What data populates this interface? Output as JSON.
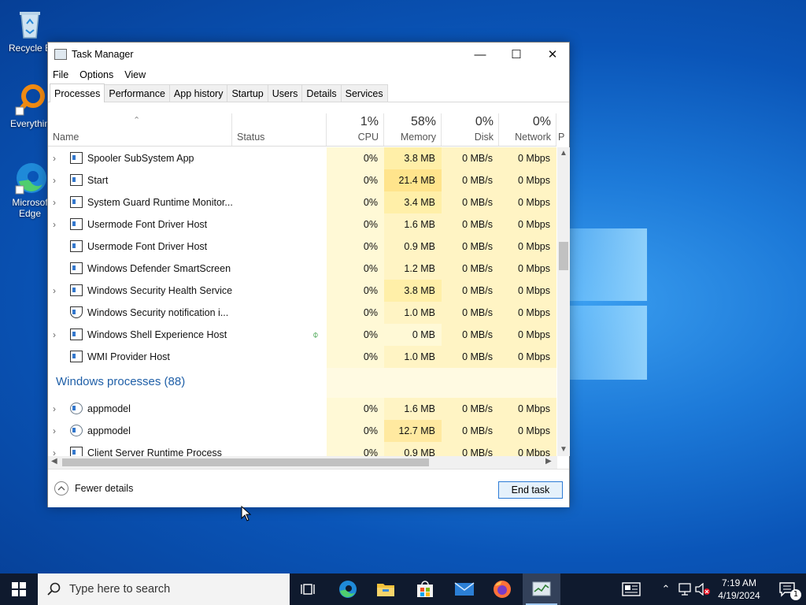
{
  "desktop": {
    "icons": [
      {
        "label": "Recycle B",
        "icon": "recycle-bin-icon"
      },
      {
        "label": "Everythin",
        "icon": "everything-search-icon"
      },
      {
        "label": "Microsof Edge",
        "icon": "edge-icon"
      }
    ]
  },
  "window": {
    "title": "Task Manager",
    "controls": {
      "minimize": "—",
      "maximize": "☐",
      "close": "✕"
    },
    "menu": [
      "File",
      "Options",
      "View"
    ],
    "tabs": [
      "Processes",
      "Performance",
      "App history",
      "Startup",
      "Users",
      "Details",
      "Services"
    ],
    "active_tab": "Processes",
    "columns": {
      "name": "Name",
      "status": "Status",
      "cpu": {
        "pct": "1%",
        "label": "CPU"
      },
      "memory": {
        "pct": "58%",
        "label": "Memory"
      },
      "disk": {
        "pct": "0%",
        "label": "Disk"
      },
      "network": {
        "pct": "0%",
        "label": "Network"
      },
      "power": "P"
    },
    "rows": [
      {
        "name": "Spooler SubSystem App",
        "expand": "›",
        "cpu": "0%",
        "memory": "3.8 MB",
        "disk": "0 MB/s",
        "network": "0 Mbps"
      },
      {
        "name": "Start",
        "expand": "›",
        "cpu": "0%",
        "memory": "21.4 MB",
        "disk": "0 MB/s",
        "network": "0 Mbps"
      },
      {
        "name": "System Guard Runtime Monitor...",
        "expand": "›",
        "cpu": "0%",
        "memory": "3.4 MB",
        "disk": "0 MB/s",
        "network": "0 Mbps"
      },
      {
        "name": "Usermode Font Driver Host",
        "expand": "›",
        "cpu": "0%",
        "memory": "1.6 MB",
        "disk": "0 MB/s",
        "network": "0 Mbps"
      },
      {
        "name": "Usermode Font Driver Host",
        "expand": "",
        "cpu": "0%",
        "memory": "0.9 MB",
        "disk": "0 MB/s",
        "network": "0 Mbps"
      },
      {
        "name": "Windows Defender SmartScreen",
        "expand": "",
        "cpu": "0%",
        "memory": "1.2 MB",
        "disk": "0 MB/s",
        "network": "0 Mbps"
      },
      {
        "name": "Windows Security Health Service",
        "expand": "›",
        "cpu": "0%",
        "memory": "3.8 MB",
        "disk": "0 MB/s",
        "network": "0 Mbps"
      },
      {
        "name": "Windows Security notification i...",
        "expand": "",
        "cpu": "0%",
        "memory": "1.0 MB",
        "disk": "0 MB/s",
        "network": "0 Mbps"
      },
      {
        "name": "Windows Shell Experience Host",
        "expand": "›",
        "cpu": "0%",
        "memory": "0 MB",
        "disk": "0 MB/s",
        "network": "0 Mbps"
      },
      {
        "name": "WMI Provider Host",
        "expand": "",
        "cpu": "0%",
        "memory": "1.0 MB",
        "disk": "0 MB/s",
        "network": "0 Mbps"
      }
    ],
    "group": {
      "label": "Windows processes (88)"
    },
    "group_rows": [
      {
        "name": "appmodel",
        "expand": "›",
        "cpu": "0%",
        "memory": "1.6 MB",
        "disk": "0 MB/s",
        "network": "0 Mbps"
      },
      {
        "name": "appmodel",
        "expand": "›",
        "cpu": "0%",
        "memory": "12.7 MB",
        "disk": "0 MB/s",
        "network": "0 Mbps"
      },
      {
        "name": "Client Server Runtime Process",
        "expand": "›",
        "cpu": "0%",
        "memory": "0.9 MB",
        "disk": "0 MB/s",
        "network": "0 Mbps"
      }
    ],
    "footer": {
      "fewer_details": "Fewer details",
      "end_task": "End task"
    }
  },
  "taskbar": {
    "search_placeholder": "Type here to search",
    "time": "7:19 AM",
    "date": "4/19/2024",
    "notification_count": "1"
  },
  "colors": {
    "accent": "#2d7bd6",
    "group": "#2060a8",
    "heat_light": "#fff9d6",
    "heat_mem": "#ffefa8"
  }
}
